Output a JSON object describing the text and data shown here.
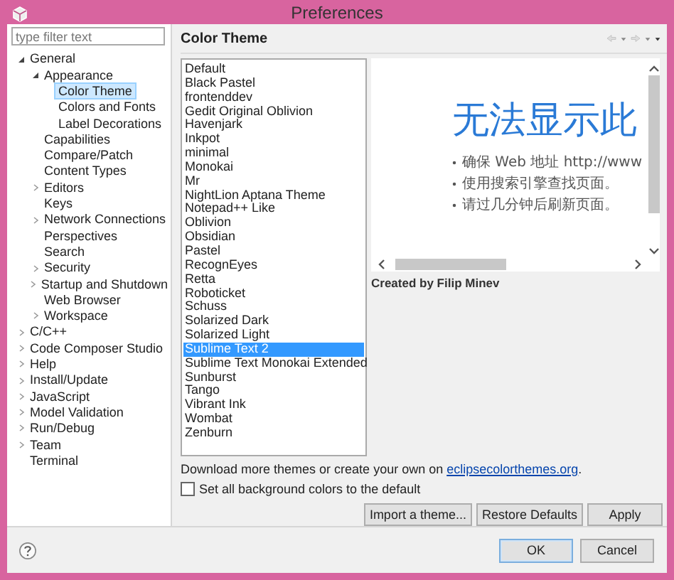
{
  "window": {
    "title": "Preferences"
  },
  "filter": {
    "placeholder": "type filter text"
  },
  "tree": [
    {
      "label": "General",
      "expanded": true,
      "selected": false,
      "children": [
        {
          "label": "Appearance",
          "expanded": true,
          "selected": false,
          "children": [
            {
              "label": "Color Theme",
              "selected": true
            },
            {
              "label": "Colors and Fonts",
              "selected": false
            },
            {
              "label": "Label Decorations",
              "selected": false
            }
          ]
        },
        {
          "label": "Capabilities",
          "selected": false
        },
        {
          "label": "Compare/Patch",
          "selected": false
        },
        {
          "label": "Content Types",
          "selected": false
        },
        {
          "label": "Editors",
          "expanded": false,
          "selected": false
        },
        {
          "label": "Keys",
          "selected": false
        },
        {
          "label": "Network Connections",
          "expanded": false,
          "selected": false
        },
        {
          "label": "Perspectives",
          "selected": false
        },
        {
          "label": "Search",
          "selected": false
        },
        {
          "label": "Security",
          "expanded": false,
          "selected": false
        },
        {
          "label": "Startup and Shutdown",
          "expanded": false,
          "selected": false
        },
        {
          "label": "Web Browser",
          "selected": false
        },
        {
          "label": "Workspace",
          "expanded": false,
          "selected": false
        }
      ]
    },
    {
      "label": "C/C++",
      "expanded": false,
      "selected": false
    },
    {
      "label": "Code Composer Studio",
      "expanded": false,
      "selected": false
    },
    {
      "label": "Help",
      "expanded": false,
      "selected": false
    },
    {
      "label": "Install/Update",
      "expanded": false,
      "selected": false
    },
    {
      "label": "JavaScript",
      "expanded": false,
      "selected": false
    },
    {
      "label": "Model Validation",
      "expanded": false,
      "selected": false
    },
    {
      "label": "Run/Debug",
      "expanded": false,
      "selected": false
    },
    {
      "label": "Team",
      "expanded": false,
      "selected": false
    },
    {
      "label": "Terminal",
      "selected": false
    }
  ],
  "page": {
    "title": "Color Theme"
  },
  "themes": [
    {
      "label": "Default",
      "selected": false
    },
    {
      "label": "Black Pastel",
      "selected": false
    },
    {
      "label": "frontenddev",
      "selected": false
    },
    {
      "label": "Gedit Original Oblivion",
      "selected": false
    },
    {
      "label": "Havenjark",
      "selected": false
    },
    {
      "label": "Inkpot",
      "selected": false
    },
    {
      "label": "minimal",
      "selected": false
    },
    {
      "label": "Monokai",
      "selected": false
    },
    {
      "label": "Mr",
      "selected": false
    },
    {
      "label": "NightLion Aptana Theme",
      "selected": false
    },
    {
      "label": "Notepad++ Like",
      "selected": false
    },
    {
      "label": "Oblivion",
      "selected": false
    },
    {
      "label": "Obsidian",
      "selected": false
    },
    {
      "label": "Pastel",
      "selected": false
    },
    {
      "label": "RecognEyes",
      "selected": false
    },
    {
      "label": "Retta",
      "selected": false
    },
    {
      "label": "Roboticket",
      "selected": false
    },
    {
      "label": "Schuss",
      "selected": false
    },
    {
      "label": "Solarized Dark",
      "selected": false
    },
    {
      "label": "Solarized Light",
      "selected": false
    },
    {
      "label": "Sublime Text 2",
      "selected": true
    },
    {
      "label": "Sublime Text Monokai Extended",
      "selected": false
    },
    {
      "label": "Sunburst",
      "selected": false
    },
    {
      "label": "Tango",
      "selected": false
    },
    {
      "label": "Vibrant Ink",
      "selected": false
    },
    {
      "label": "Wombat",
      "selected": false
    },
    {
      "label": "Zenburn",
      "selected": false
    }
  ],
  "preview": {
    "heading": "无法显示此",
    "bullets": [
      "确保 Web 地址 http://www",
      "使用搜索引擎查找页面。",
      "请过几分钟后刷新页面。"
    ]
  },
  "author": "Created by Filip Minev",
  "download": {
    "text": "Download more themes or create your own on ",
    "link": "eclipsecolorthemes.org",
    "suffix": "."
  },
  "reset_backgrounds": {
    "label": "Set all background colors to the default",
    "checked": false
  },
  "page_buttons": [
    "Import a theme...",
    "Restore Defaults",
    "Apply"
  ],
  "dialog_buttons": [
    {
      "label": "OK",
      "default": true
    },
    {
      "label": "Cancel",
      "default": false
    }
  ]
}
